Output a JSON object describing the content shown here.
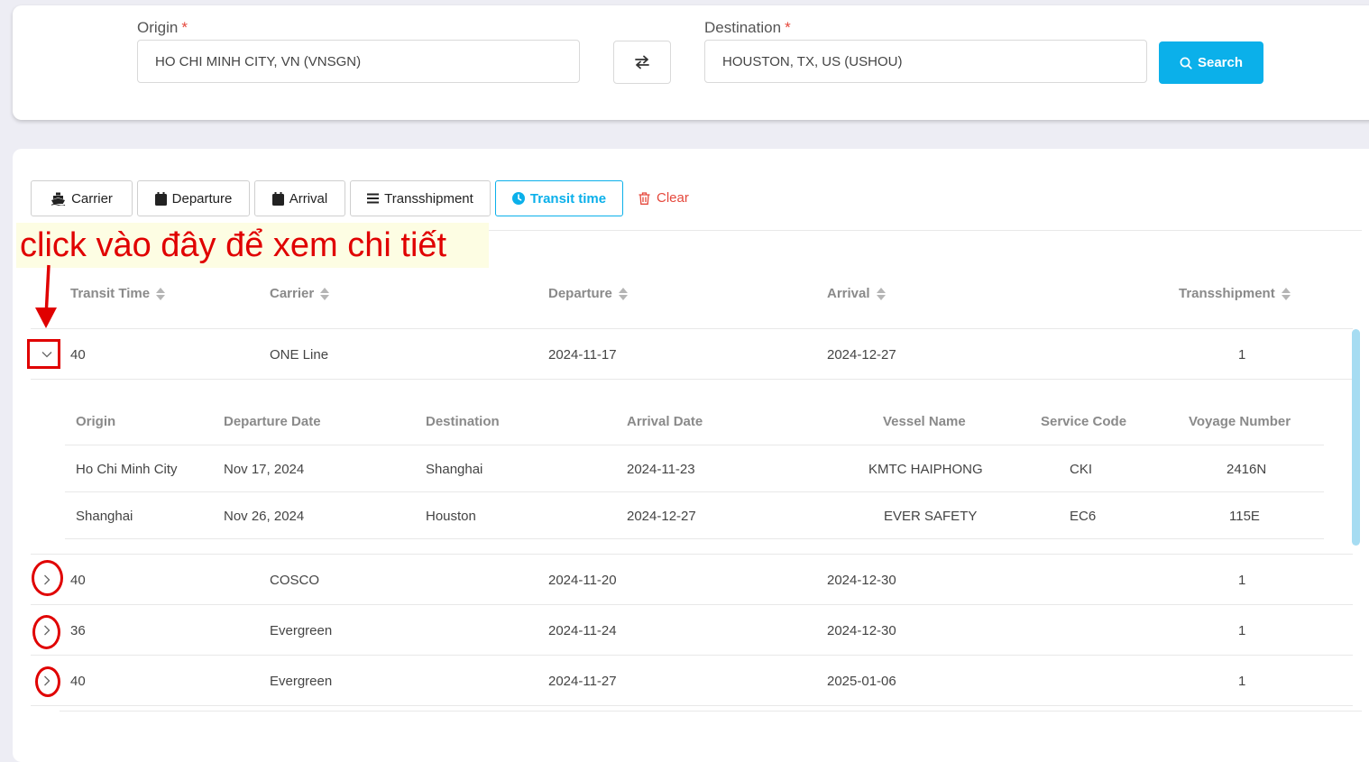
{
  "search": {
    "origin_label": "Origin",
    "origin_value": "HO CHI MINH CITY, VN (VNSGN)",
    "destination_label": "Destination",
    "destination_value": "HOUSTON, TX, US (USHOU)",
    "required_mark": "*",
    "search_label": "Search"
  },
  "filters": {
    "carrier": "Carrier",
    "departure": "Departure",
    "arrival": "Arrival",
    "transshipment": "Transshipment",
    "transit_time": "Transit time",
    "clear": "Clear"
  },
  "annotation_text": "click vào đây để xem chi tiết",
  "table": {
    "headers": {
      "transit_time": "Transit Time",
      "carrier": "Carrier",
      "departure": "Departure",
      "arrival": "Arrival",
      "transshipment": "Transshipment"
    },
    "rows": [
      {
        "transit": "40",
        "carrier": "ONE Line",
        "departure": "2024-11-17",
        "arrival": "2024-12-27",
        "transshipment": "1"
      },
      {
        "transit": "40",
        "carrier": "COSCO",
        "departure": "2024-11-20",
        "arrival": "2024-12-30",
        "transshipment": "1"
      },
      {
        "transit": "36",
        "carrier": "Evergreen",
        "departure": "2024-11-24",
        "arrival": "2024-12-30",
        "transshipment": "1"
      },
      {
        "transit": "40",
        "carrier": "Evergreen",
        "departure": "2024-11-27",
        "arrival": "2025-01-06",
        "transshipment": "1"
      }
    ]
  },
  "detail": {
    "headers": {
      "origin": "Origin",
      "departure_date": "Departure Date",
      "destination": "Destination",
      "arrival_date": "Arrival Date",
      "vessel_name": "Vessel Name",
      "service_code": "Service Code",
      "voyage_number": "Voyage Number"
    },
    "legs": [
      {
        "origin": "Ho Chi Minh City",
        "departure_date": "Nov 17, 2024",
        "destination": "Shanghai",
        "arrival_date": "2024-11-23",
        "vessel": "KMTC HAIPHONG",
        "service": "CKI",
        "voyage": "2416N"
      },
      {
        "origin": "Shanghai",
        "departure_date": "Nov 26, 2024",
        "destination": "Houston",
        "arrival_date": "2024-12-27",
        "vessel": "EVER SAFETY",
        "service": "EC6",
        "voyage": "115E"
      }
    ]
  },
  "colors": {
    "accent": "#0bb0ea",
    "danger": "#e5483c",
    "annotation": "#e00000",
    "annotation_bg": "#fdfde3"
  }
}
